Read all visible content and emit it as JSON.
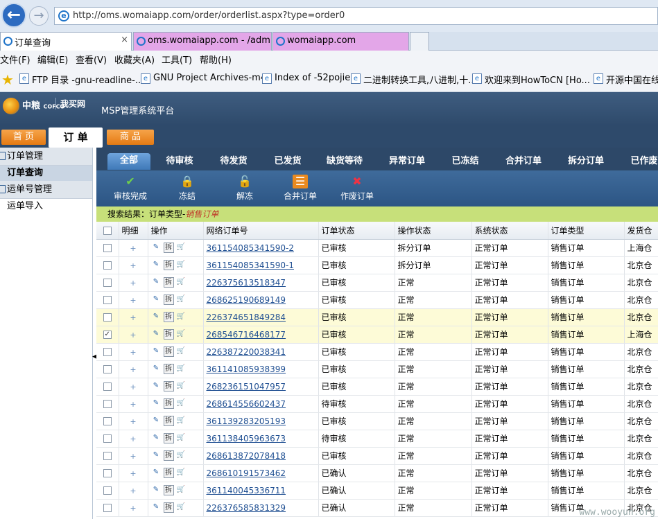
{
  "browser": {
    "url": "http://oms.womaiapp.com/order/orderlist.aspx?type=order0",
    "tabs": [
      {
        "label": "订单查询",
        "close": "×"
      },
      {
        "label": "oms.womaiapp.com - /adm..."
      },
      {
        "label": "womaiapp.com"
      }
    ],
    "menu": [
      "文件(F)",
      "编辑(E)",
      "查看(V)",
      "收藏夹(A)",
      "工具(T)",
      "帮助(H)"
    ],
    "favorites": [
      "FTP 目录 -gnu-readline-...",
      "GNU Project Archives-m4",
      "Index of -52pojie",
      "二进制转换工具,八进制,十...",
      "欢迎来到HowToCN [Ho...",
      "开源中国在线"
    ]
  },
  "app": {
    "logo_cofco": "中粮",
    "logo_cofco_sub": "COFCO",
    "logo_womai": "我买网",
    "title": "MSP管理系统平台",
    "main_tabs": [
      "首 页",
      "订 单",
      "商 品"
    ],
    "active_main_tab": "订 单"
  },
  "sidebar": {
    "groups": [
      {
        "label": "订单管理",
        "items": [
          "订单查询"
        ]
      },
      {
        "label": "运单号管理",
        "items": [
          "运单导入"
        ]
      }
    ],
    "active_item": "订单查询"
  },
  "subtabs": [
    "全部",
    "待审核",
    "待发货",
    "已发货",
    "缺货等待",
    "异常订单",
    "已冻结",
    "合并订单",
    "拆分订单",
    "已作废"
  ],
  "active_subtab": "全部",
  "toolbar": [
    {
      "label": "审核完成",
      "icon": "check-icon"
    },
    {
      "label": "冻结",
      "icon": "lock-icon"
    },
    {
      "label": "解冻",
      "icon": "unlock-icon"
    },
    {
      "label": "合并订单",
      "icon": "merge-icon"
    },
    {
      "label": "作废订单",
      "icon": "void-icon"
    }
  ],
  "search_result": {
    "prefix": "搜索结果：订单类型-",
    "type": "销售订单"
  },
  "table": {
    "columns": [
      "",
      "明细",
      "操作",
      "网络订单号",
      "订单状态",
      "操作状态",
      "系统状态",
      "订单类型",
      "发货仓"
    ],
    "rows": [
      {
        "order": "361154085341590-2",
        "status": "已审核",
        "op_status": "拆分订单",
        "sys_status": "正常订单",
        "type": "销售订单",
        "warehouse": "上海仓",
        "checked": false,
        "highlight": false
      },
      {
        "order": "361154085341590-1",
        "status": "已审核",
        "op_status": "拆分订单",
        "sys_status": "正常订单",
        "type": "销售订单",
        "warehouse": "北京仓",
        "checked": false,
        "highlight": false
      },
      {
        "order": "226375613518347",
        "status": "已审核",
        "op_status": "正常",
        "sys_status": "正常订单",
        "type": "销售订单",
        "warehouse": "北京仓",
        "checked": false,
        "highlight": false
      },
      {
        "order": "268625190689149",
        "status": "已审核",
        "op_status": "正常",
        "sys_status": "正常订单",
        "type": "销售订单",
        "warehouse": "北京仓",
        "checked": false,
        "highlight": false
      },
      {
        "order": "226374651849284",
        "status": "已审核",
        "op_status": "正常",
        "sys_status": "正常订单",
        "type": "销售订单",
        "warehouse": "北京仓",
        "checked": false,
        "highlight": true
      },
      {
        "order": "268546716468177",
        "status": "已审核",
        "op_status": "正常",
        "sys_status": "正常订单",
        "type": "销售订单",
        "warehouse": "上海仓",
        "checked": true,
        "highlight": true
      },
      {
        "order": "226387220038341",
        "status": "已审核",
        "op_status": "正常",
        "sys_status": "正常订单",
        "type": "销售订单",
        "warehouse": "北京仓",
        "checked": false,
        "highlight": false
      },
      {
        "order": "361141085938399",
        "status": "已审核",
        "op_status": "正常",
        "sys_status": "正常订单",
        "type": "销售订单",
        "warehouse": "北京仓",
        "checked": false,
        "highlight": false
      },
      {
        "order": "268236151047957",
        "status": "已审核",
        "op_status": "正常",
        "sys_status": "正常订单",
        "type": "销售订单",
        "warehouse": "北京仓",
        "checked": false,
        "highlight": false
      },
      {
        "order": "268614556602437",
        "status": "待审核",
        "op_status": "正常",
        "sys_status": "正常订单",
        "type": "销售订单",
        "warehouse": "北京仓",
        "checked": false,
        "highlight": false
      },
      {
        "order": "361139283205193",
        "status": "已审核",
        "op_status": "正常",
        "sys_status": "正常订单",
        "type": "销售订单",
        "warehouse": "北京仓",
        "checked": false,
        "highlight": false
      },
      {
        "order": "361138405963673",
        "status": "待审核",
        "op_status": "正常",
        "sys_status": "正常订单",
        "type": "销售订单",
        "warehouse": "北京仓",
        "checked": false,
        "highlight": false
      },
      {
        "order": "268613872078418",
        "status": "已审核",
        "op_status": "正常",
        "sys_status": "正常订单",
        "type": "销售订单",
        "warehouse": "北京仓",
        "checked": false,
        "highlight": false
      },
      {
        "order": "268610191573462",
        "status": "已确认",
        "op_status": "正常",
        "sys_status": "正常订单",
        "type": "销售订单",
        "warehouse": "北京仓",
        "checked": false,
        "highlight": false
      },
      {
        "order": "361140045336711",
        "status": "已确认",
        "op_status": "正常",
        "sys_status": "正常订单",
        "type": "销售订单",
        "warehouse": "北京仓",
        "checked": false,
        "highlight": false
      },
      {
        "order": "226376585831329",
        "status": "已确认",
        "op_status": "正常",
        "sys_status": "正常订单",
        "type": "销售订单",
        "warehouse": "北京仓",
        "checked": false,
        "highlight": false
      }
    ],
    "plus_symbol": "+",
    "op_split_label": "拆"
  },
  "watermark": "www.wooyun.org",
  "colors": {
    "header_dark": "#2e4a6b",
    "orange_tab": "#e47a13",
    "search_bar": "#c7e07a",
    "row_highlight": "#fdfbd7",
    "link": "#1f4f92"
  }
}
